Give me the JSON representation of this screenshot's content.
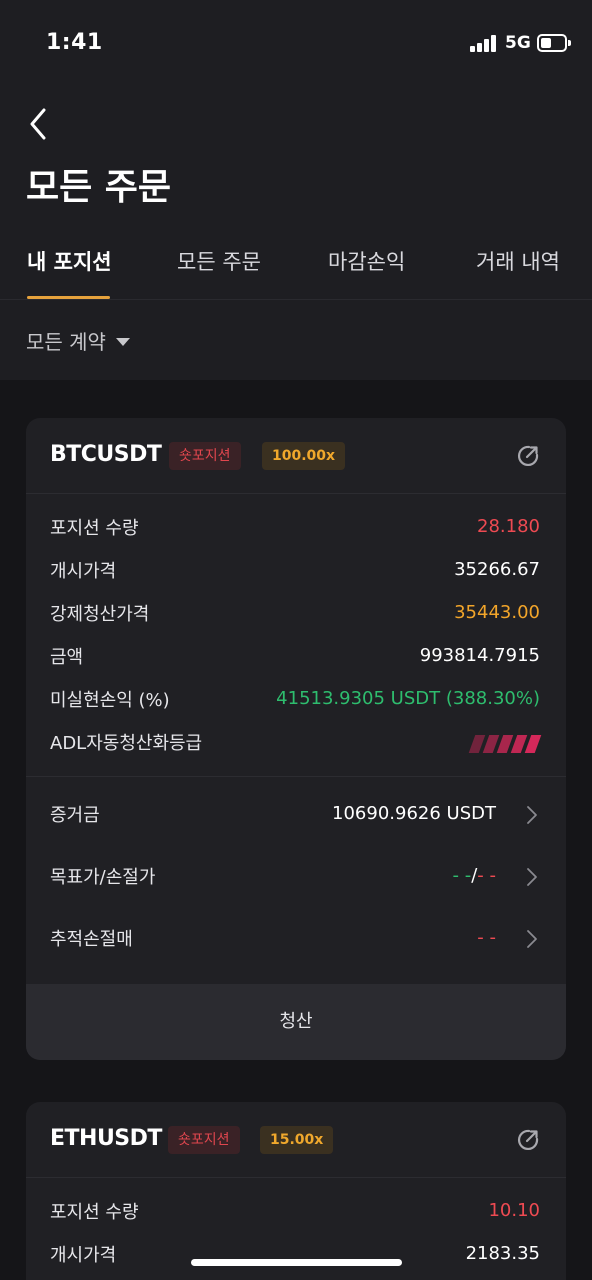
{
  "status_bar": {
    "time": "1:41",
    "network": "5G"
  },
  "header": {
    "title": "모든 주문"
  },
  "tabs": [
    {
      "label": "내 포지션",
      "active": true
    },
    {
      "label": "모든 주문",
      "active": false
    },
    {
      "label": "마감손익",
      "active": false
    },
    {
      "label": "거래 내역",
      "active": false
    }
  ],
  "filter": {
    "label": "모든 계약"
  },
  "positions": [
    {
      "symbol": "BTCUSDT",
      "side_badge": "숏포지션",
      "leverage": "100.00x",
      "rows": [
        {
          "label": "포지션 수량",
          "value": "28.180"
        },
        {
          "label": "개시가격",
          "value": "35266.67"
        },
        {
          "label": "강제청산가격",
          "value": "35443.00"
        },
        {
          "label": "금액",
          "value": "993814.7915"
        },
        {
          "label": "미실현손익 (%)",
          "value": "41513.9305 USDT (388.30%)"
        },
        {
          "label": "ADL자동청산화등급",
          "value": ""
        }
      ],
      "links": [
        {
          "label": "증거금",
          "value": "10690.9626 USDT"
        },
        {
          "label": "목표가/손절가",
          "value_tp": "- -",
          "value_sep": "/",
          "value_sl": "- -"
        },
        {
          "label": "추적손절매",
          "value": "- -"
        }
      ],
      "close_label": "청산"
    },
    {
      "symbol": "ETHUSDT",
      "side_badge": "숏포지션",
      "leverage": "15.00x",
      "rows": [
        {
          "label": "포지션 수량",
          "value": "10.10"
        },
        {
          "label": "개시가격",
          "value": "2183.35"
        }
      ]
    }
  ],
  "colors": {
    "accent": "#e6a23c",
    "short_red": "#ee4a52",
    "profit_green": "#2ebd6e",
    "warning_gold": "#f2a52a",
    "adl_bar": "#d5285a"
  },
  "adl_level": {
    "filled": 5,
    "total": 5
  }
}
